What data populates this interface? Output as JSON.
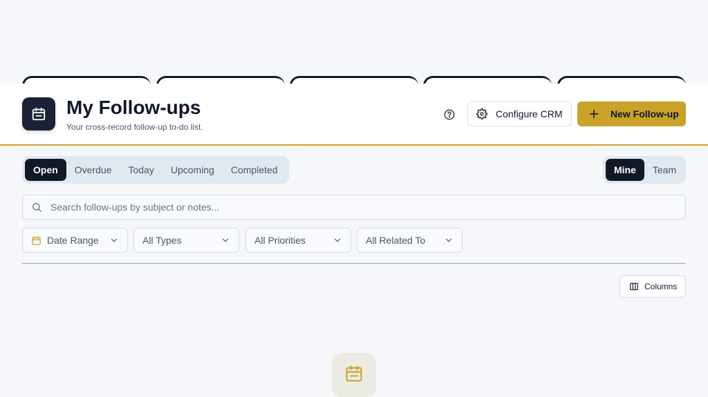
{
  "header": {
    "title": "My Follow-ups",
    "subtitle": "Your cross-record follow-up to-do list.",
    "configure_label": "Configure CRM",
    "new_label": "New Follow-up"
  },
  "status_tabs": [
    {
      "label": "Open",
      "active": true
    },
    {
      "label": "Overdue",
      "active": false
    },
    {
      "label": "Today",
      "active": false
    },
    {
      "label": "Upcoming",
      "active": false
    },
    {
      "label": "Completed",
      "active": false
    }
  ],
  "scope_tabs": [
    {
      "label": "Mine",
      "active": true
    },
    {
      "label": "Team",
      "active": false
    }
  ],
  "search": {
    "placeholder": "Search follow-ups by subject or notes..."
  },
  "filters": [
    {
      "label": "Date Range",
      "icon": "calendar-icon"
    },
    {
      "label": "All Types"
    },
    {
      "label": "All Priorities"
    },
    {
      "label": "All Related To"
    }
  ],
  "toolbar": {
    "columns_label": "Columns"
  },
  "colors": {
    "accent": "#c9a227",
    "dark": "#111827"
  }
}
